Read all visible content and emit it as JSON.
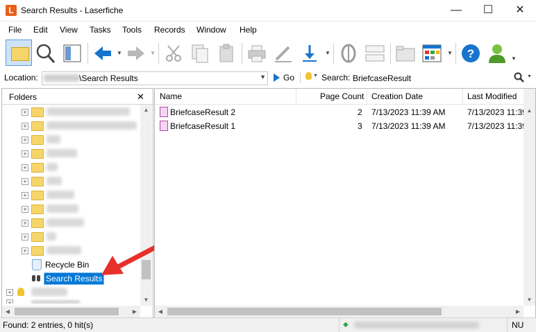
{
  "window": {
    "title": "Search Results - Laserfiche",
    "logo_letter": "L",
    "minimize": "—",
    "maximize": "☐",
    "close": "✕"
  },
  "menu": [
    "File",
    "Edit",
    "View",
    "Tasks",
    "Tools",
    "Records",
    "Window",
    "Help"
  ],
  "locationbar": {
    "location_label": "Location:",
    "location_value": "\\Search Results",
    "go_label": "Go",
    "search_label": "Search:",
    "search_value": "BriefcaseResult"
  },
  "folders": {
    "title": "Folders",
    "close": "✕",
    "recycle_bin": "Recycle Bin",
    "search_results": "Search Results"
  },
  "table": {
    "headers": {
      "name": "Name",
      "page_count": "Page Count",
      "creation_date": "Creation Date",
      "last_modified": "Last Modified"
    },
    "rows": [
      {
        "name": "BriefcaseResult 2",
        "page_count": "2",
        "creation_date": "7/13/2023 11:39 AM",
        "last_modified": "7/13/2023 11:39"
      },
      {
        "name": "BriefcaseResult 1",
        "page_count": "3",
        "creation_date": "7/13/2023 11:39 AM",
        "last_modified": "7/13/2023 11:39"
      }
    ]
  },
  "status": {
    "found": "Found: 2 entries, 0 hit(s)",
    "mode": "NU"
  },
  "colors": {
    "accent": "#1874cd",
    "arrow": "#e8302a",
    "selection": "#0078d7",
    "logo": "#e8601c"
  }
}
